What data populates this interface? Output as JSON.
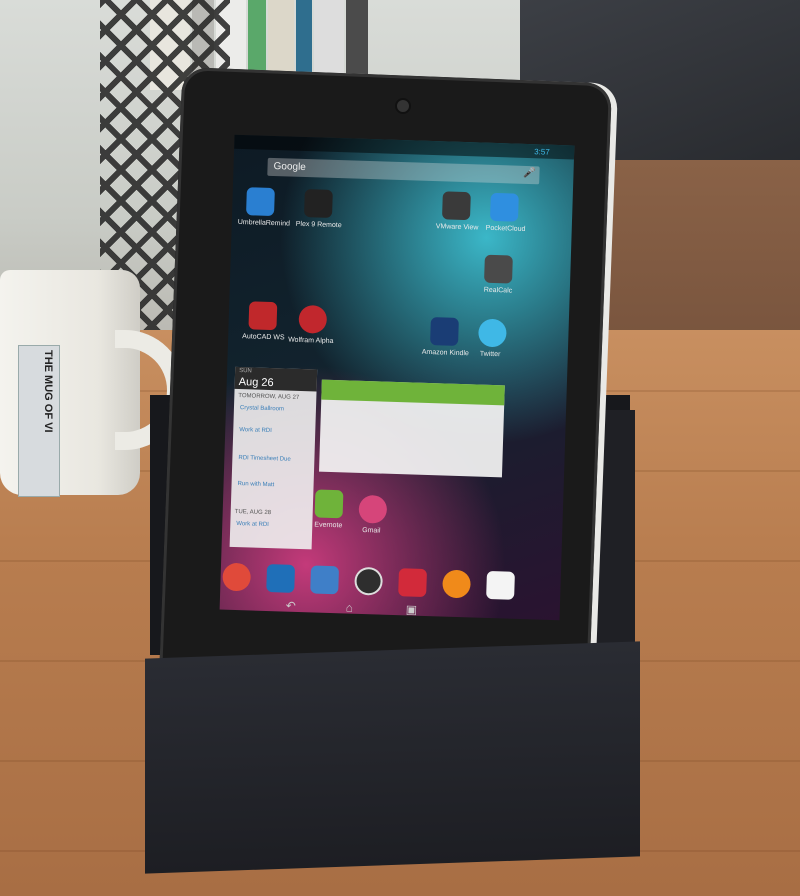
{
  "scene": {
    "mug_text": "THE MUG OF VI"
  },
  "status_bar": {
    "time": "3:57"
  },
  "search": {
    "label": "Google"
  },
  "apps": [
    {
      "label": "UmbrellaRemind",
      "color": "#2a7fd1"
    },
    {
      "label": "Plex 9 Remote",
      "color": "#222222"
    },
    {
      "label": "VMware View",
      "color": "#3a3a3a"
    },
    {
      "label": "PocketCloud",
      "color": "#2f8fe0"
    },
    {
      "label": "RealCalc",
      "color": "#4a4a4a"
    },
    {
      "label": "AutoCAD WS",
      "color": "#c0282b"
    },
    {
      "label": "Wolfram Alpha",
      "color": "#c1272d"
    },
    {
      "label": "Amazon Kindle",
      "color": "#1a3d75"
    },
    {
      "label": "Twitter",
      "color": "#3fb8e6"
    },
    {
      "label": "Evernote",
      "color": "#6fb33a"
    },
    {
      "label": "Gmail",
      "color": "#d6457a"
    }
  ],
  "calendar_widget": {
    "day": "SUN",
    "date": "Aug 26",
    "tomorrow_label": "TOMORROW, AUG 27",
    "events": [
      "Crystal Ballroom",
      "Work at RDI",
      "RDI Timesheet Due",
      "Run with Matt"
    ],
    "next_day_label": "TUE, AUG 28",
    "next_event": "Work at RDI"
  },
  "dock": {
    "icons": [
      "chrome-icon",
      "maps-icon",
      "books-icon",
      "apps-grid-icon",
      "movies-icon",
      "music-icon",
      "play-store-icon"
    ]
  },
  "colors": {
    "tablet_bezel": "#1a1a1a",
    "box": "#1d1e23",
    "desk": "#b87d4f",
    "evernote_green": "#6fb33a"
  }
}
